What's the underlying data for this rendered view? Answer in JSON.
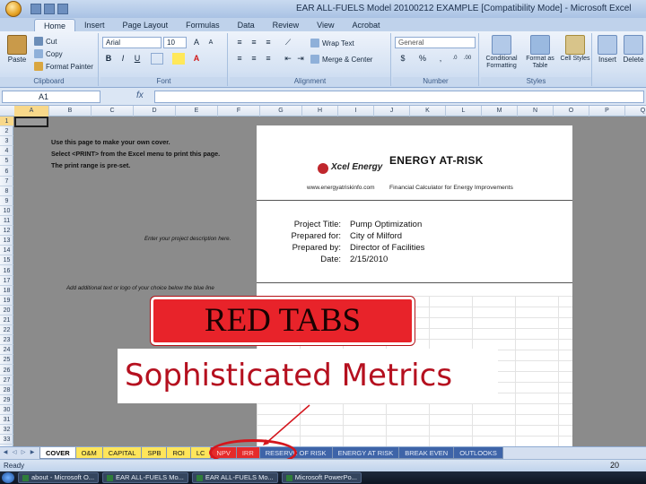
{
  "window": {
    "title": "EAR ALL-FUELS Model 20100212 EXAMPLE [Compatibility Mode] - Microsoft Excel"
  },
  "ribbon": {
    "tabs": [
      "Home",
      "Insert",
      "Page Layout",
      "Formulas",
      "Data",
      "Review",
      "View",
      "Acrobat"
    ],
    "active_tab": "Home",
    "clipboard": {
      "paste": "Paste",
      "cut": "Cut",
      "copy": "Copy",
      "format_painter": "Format Painter",
      "label": "Clipboard"
    },
    "font": {
      "name": "Arial",
      "size": "10",
      "label": "Font"
    },
    "alignment": {
      "wrap_text": "Wrap Text",
      "merge_center": "Merge & Center",
      "label": "Alignment"
    },
    "number": {
      "format": "General",
      "currency": "$",
      "percent": "%",
      "label": "Number"
    },
    "styles": {
      "conditional": "Conditional Formatting",
      "format_table": "Format as Table",
      "cell_styles": "Cell Styles",
      "label": "Styles"
    },
    "cells": {
      "insert": "Insert",
      "delete": "Delete"
    }
  },
  "formula_bar": {
    "name_box": "A1",
    "fx": "fx",
    "value": ""
  },
  "columns": [
    "A",
    "B",
    "C",
    "D",
    "E",
    "F",
    "G",
    "H",
    "I",
    "J",
    "K",
    "L",
    "M",
    "N",
    "O",
    "P",
    "Q"
  ],
  "rows": [
    "1",
    "2",
    "3",
    "4",
    "5",
    "6",
    "7",
    "8",
    "9",
    "10",
    "11",
    "12",
    "13",
    "14",
    "15",
    "16",
    "17",
    "18",
    "19",
    "20",
    "21",
    "22",
    "23",
    "24",
    "25",
    "26",
    "27",
    "28",
    "29",
    "30",
    "31",
    "32",
    "33"
  ],
  "instructions": {
    "line1": "Use this page to make your own cover.",
    "line2": "Select <PRINT> from the Excel menu to print this page.",
    "line3": "The print range is pre-set."
  },
  "notes": {
    "project_desc": "Enter your project description here.",
    "logo": "Add additional text or logo of your choice below the blue line"
  },
  "cover": {
    "logo_text": "Xcel Energy",
    "website": "www.energyatriskinfo.com",
    "title": "ENERGY AT-RISK",
    "subtitle": "Financial Calculator for Energy Improvements",
    "fields": [
      {
        "label": "Project Title:",
        "value": "Pump Optimization"
      },
      {
        "label": "Prepared for:",
        "value": "City of Milford"
      },
      {
        "label": "Prepared by:",
        "value": "Director of Facilities"
      },
      {
        "label": "Date:",
        "value": "2/15/2010"
      }
    ]
  },
  "overlays": {
    "red_tabs": "RED TABS",
    "metrics": "Sophisticated Metrics"
  },
  "sheet_tabs": [
    {
      "label": "COVER",
      "style": "active"
    },
    {
      "label": "O&M",
      "style": "yellow"
    },
    {
      "label": "CAPITAL",
      "style": "yellow"
    },
    {
      "label": "SPB",
      "style": "yellow"
    },
    {
      "label": "ROI",
      "style": "yellow"
    },
    {
      "label": "LC",
      "style": "yellow"
    },
    {
      "label": "NPV",
      "style": "red"
    },
    {
      "label": "IRR",
      "style": "red"
    },
    {
      "label": "RESERVE OF RISK",
      "style": "blue"
    },
    {
      "label": "ENERGY AT RISK",
      "style": "blue"
    },
    {
      "label": "BREAK EVEN",
      "style": "blue"
    },
    {
      "label": "OUTLOOKS",
      "style": "blue"
    }
  ],
  "status": {
    "text": "Ready",
    "page_number": "20"
  },
  "taskbar": [
    "about - Microsoft O...",
    "EAR ALL-FUELS Mo...",
    "EAR ALL-FUELS Mo...",
    "Microsoft PowerPo..."
  ],
  "colors": {
    "red_tab": "#e52b2b",
    "yellow_tab": "#ffe55a",
    "blue_tab": "#3e64a8",
    "highlight_circle": "#d4161d"
  }
}
